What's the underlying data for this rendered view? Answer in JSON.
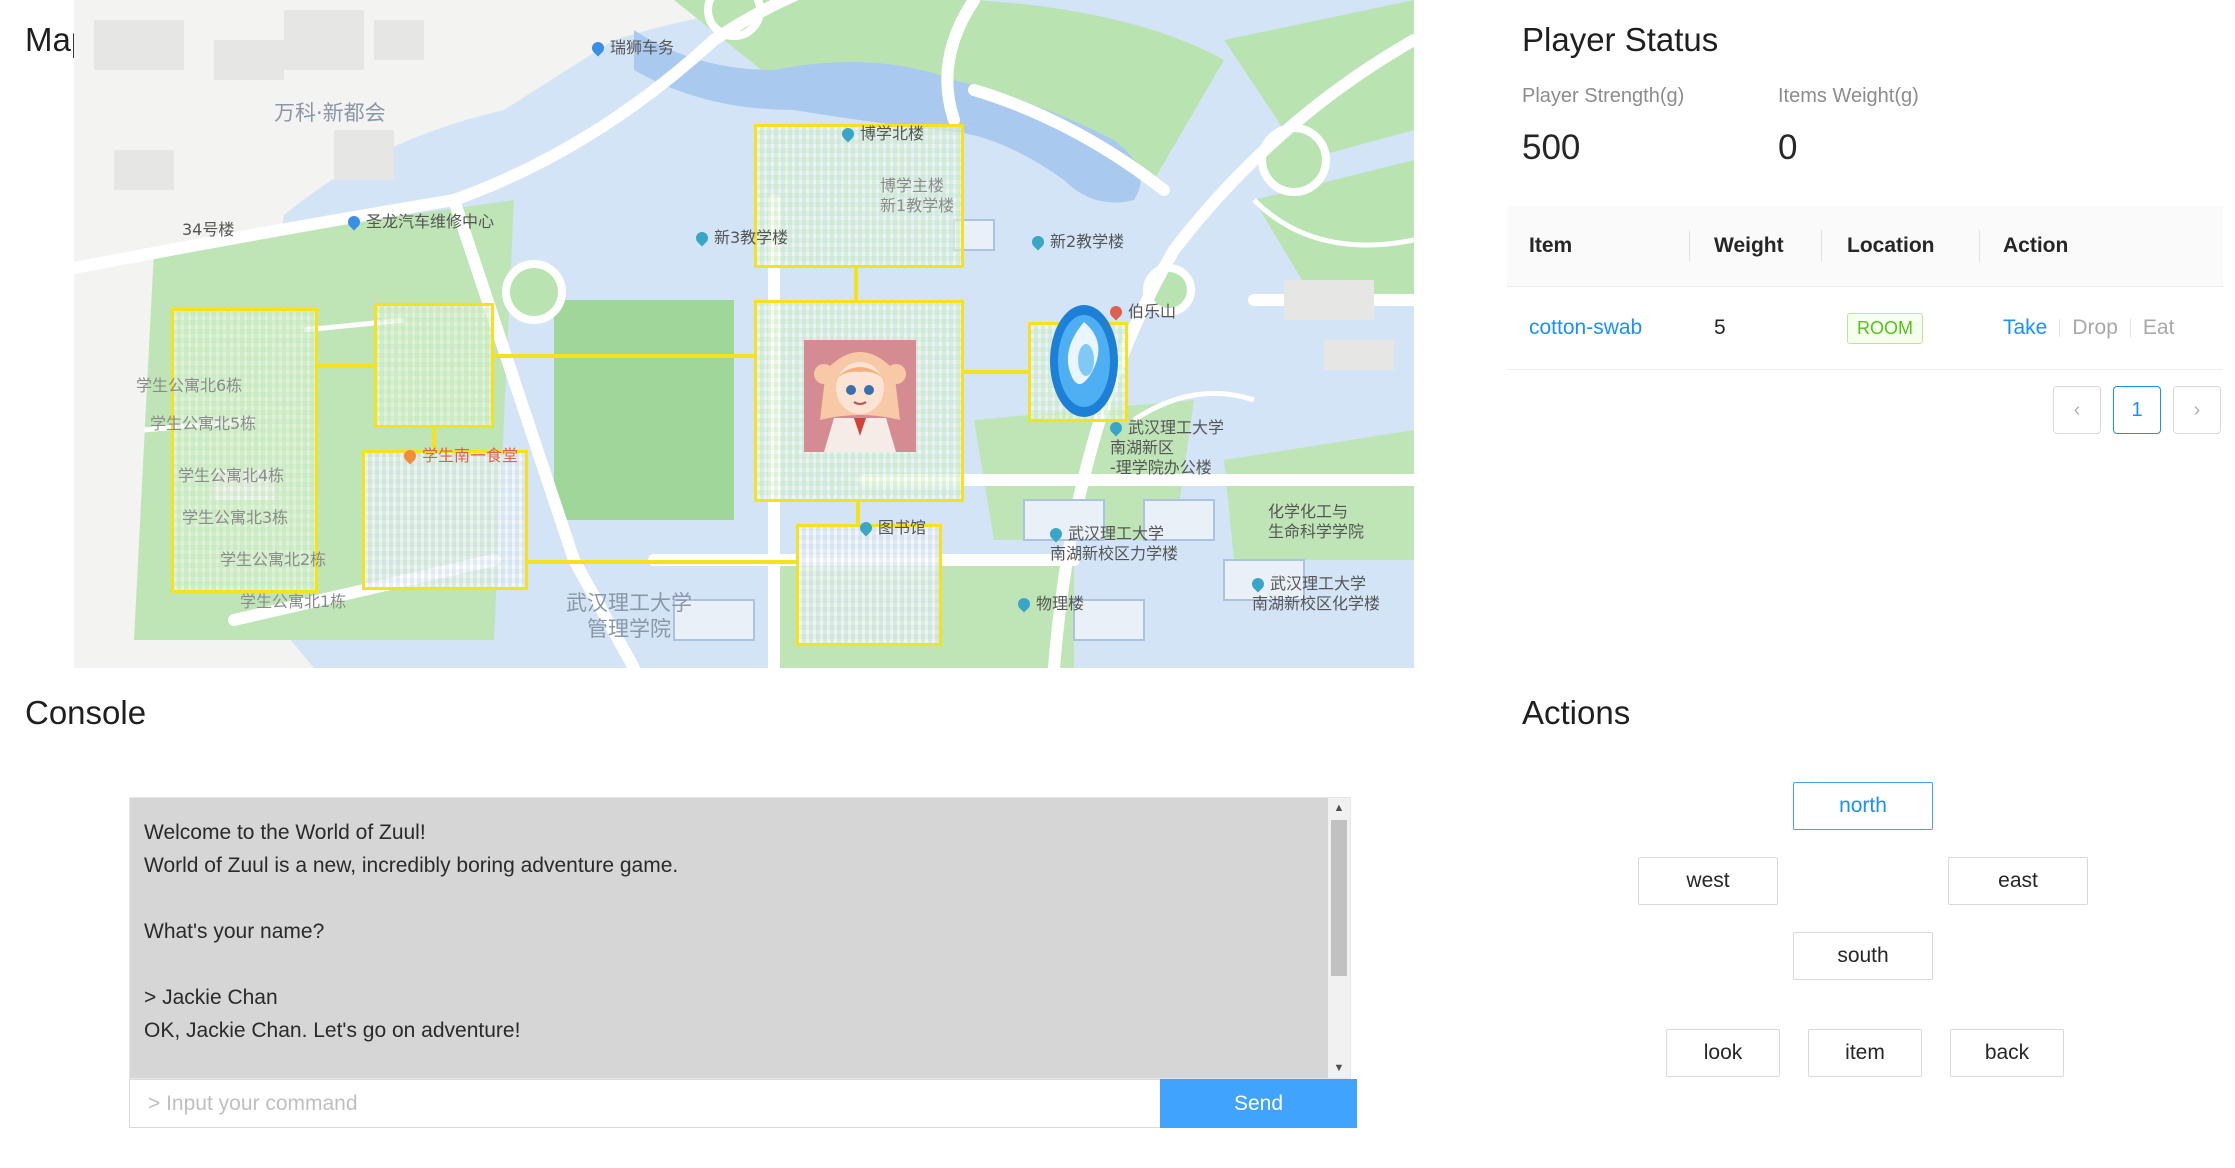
{
  "map": {
    "title": "Map",
    "labels": {
      "l1": "瑞狮车务",
      "l2": "万科·新都会",
      "l3": "34号楼",
      "l4": "圣龙汽车维修中心",
      "l5": "博学北楼",
      "l6": "博学主楼",
      "l7": "新1教学楼",
      "l8": "新3教学楼",
      "l9": "新2教学楼",
      "l10": "伯乐山",
      "l11": "学生公寓北6栋",
      "l12": "学生公寓北5栋",
      "l13": "学生公寓北4栋",
      "l14": "学生公寓北3栋",
      "l15": "学生公寓北2栋",
      "l16": "学生公寓北1栋",
      "l17": "学生南一食堂",
      "l18": "武汉理工大学\n南湖新区\n-理学院办公楼",
      "l19": "化学化工与\n生命科学学院",
      "l20": "图书馆",
      "l21": "武汉理工大学\n南湖新校区力学楼",
      "l22": "武汉理工大学\n管理学院",
      "l23": "物理楼",
      "l24": "武汉理工大学\n南湖新校区化学楼"
    }
  },
  "status": {
    "title": "Player Status",
    "strength_label": "Player Strength(g)",
    "strength_value": "500",
    "weight_label": "Items Weight(g)",
    "weight_value": "0"
  },
  "table": {
    "headers": {
      "item": "Item",
      "weight": "Weight",
      "location": "Location",
      "action": "Action"
    },
    "rows": [
      {
        "item": "cotton-swab",
        "weight": "5",
        "location": "ROOM",
        "take": "Take",
        "drop": "Drop",
        "eat": "Eat"
      }
    ]
  },
  "pagination": {
    "prev": "‹",
    "current": "1",
    "next": "›"
  },
  "console": {
    "title": "Console",
    "lines": [
      "Welcome to the World of Zuul!",
      "World of Zuul is a new, incredibly boring adventure game.",
      "",
      "What's your name?",
      "",
      "> Jackie Chan",
      "OK, Jackie Chan. Let's go on adventure!"
    ],
    "input_placeholder": "> Input your command",
    "input_value": "",
    "send_label": "Send"
  },
  "actions": {
    "title": "Actions",
    "north": "north",
    "west": "west",
    "east": "east",
    "south": "south",
    "look": "look",
    "item": "item",
    "back": "back"
  },
  "colors": {
    "accent": "#1890ff",
    "send_button": "#40a4ff",
    "room_border": "#f6e21c",
    "map_water": "#c9def5",
    "map_green": "#b7e3b0",
    "tag_green": "#52c41a"
  }
}
